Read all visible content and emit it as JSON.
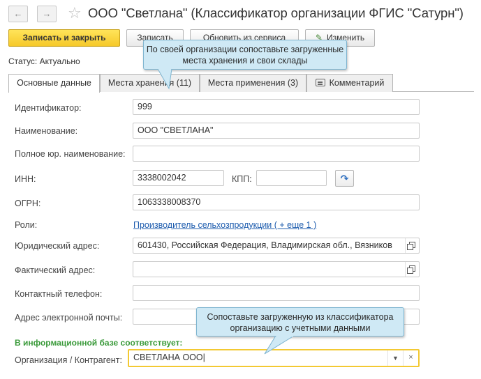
{
  "header": {
    "back_icon": "arrow-left-icon",
    "forward_icon": "arrow-right-icon",
    "favorite_icon": "star-icon",
    "title": "ООО \"Светлана\"  (Классификатор организации ФГИС \"Сатурн\")"
  },
  "toolbar": {
    "save_close_label": "Записать и закрыть",
    "save_label": "Записать",
    "refresh_label": "Обновить из сервиса",
    "edit_label": "Изменить",
    "edit_icon": "pencil-icon"
  },
  "status": "Статус:  Актуально",
  "tabs": [
    {
      "label": "Основные данные"
    },
    {
      "label": "Места хранения (11)"
    },
    {
      "label": "Места применения (3)"
    },
    {
      "label": "Комментарий",
      "icon": "comment-icon"
    }
  ],
  "form": {
    "identifier_label": "Идентификатор:",
    "identifier_value": "999",
    "name_label": "Наименование:",
    "name_value": "ООО \"СВЕТЛАНА\"",
    "full_name_label": "Полное юр. наименование:",
    "full_name_value": "",
    "inn_label": "ИНН:",
    "inn_value": "3338002042",
    "kpp_label": "КПП:",
    "kpp_value": "",
    "ogrn_label": "ОГРН:",
    "ogrn_value": "1063338008370",
    "roles_label": "Роли:",
    "roles_link": "Производитель сельхозпродукции ( + еще 1 )",
    "legal_address_label": "Юридический адрес:",
    "legal_address_value": "601430, Российская Федерация, Владимирская обл., Вязников",
    "actual_address_label": "Фактический адрес:",
    "actual_address_value": "",
    "phone_label": "Контактный телефон:",
    "phone_value": "",
    "email_label": "Адрес электронной почты:",
    "email_value": "",
    "matches_label": "В информационной базе соответствует:",
    "org_label": "Организация / Контрагент:",
    "org_value": "СВЕТЛАНА ООО"
  },
  "callouts": {
    "top": "По своей организации сопоставьте загруженные места хранения и свои склады",
    "bottom": "Сопоставьте загруженную из классификатора организацию с учетными данными"
  },
  "colors": {
    "primary_button": "#f6c92a",
    "link": "#1d5cae",
    "callout_bg": "#cfe9f5",
    "green_label": "#3a9a3a",
    "focus_border": "#f3c932"
  }
}
